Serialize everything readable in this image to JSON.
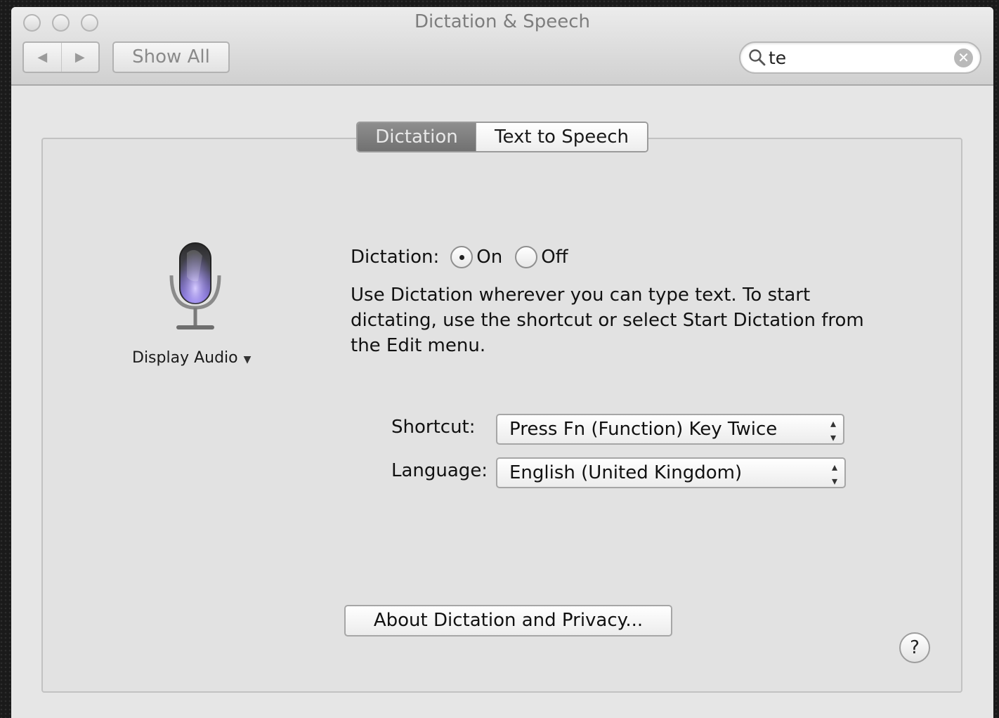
{
  "window": {
    "title": "Dictation & Speech"
  },
  "toolbar": {
    "back_icon": "◀",
    "forward_icon": "▶",
    "show_all_label": "Show All",
    "search_value": "te",
    "search_placeholder": "",
    "clear_icon": "✕"
  },
  "tabs": [
    {
      "label": "Dictation",
      "selected": true
    },
    {
      "label": "Text to Speech",
      "selected": false
    }
  ],
  "dictation": {
    "device_label": "Display Audio",
    "device_caret": "▼",
    "toggle_label": "Dictation:",
    "on_label": "On",
    "off_label": "Off",
    "selected": "On",
    "description": "Use Dictation wherever you can type text. To start dictating, use the shortcut or select Start Dictation from the Edit menu.",
    "shortcut_label": "Shortcut:",
    "shortcut_value": "Press Fn (Function) Key Twice",
    "language_label": "Language:",
    "language_value": "English (United Kingdom)",
    "popup_arrows": "▴▾",
    "about_button": "About Dictation and Privacy...",
    "help_label": "?"
  },
  "colors": {
    "mic_glow": "#8f7bf0",
    "tab_active": "#7c7c7c"
  },
  "icons": [
    "close-window-icon",
    "minimize-window-icon",
    "zoom-window-icon",
    "search-icon",
    "clear-search-icon",
    "microphone-icon",
    "help-icon"
  ]
}
